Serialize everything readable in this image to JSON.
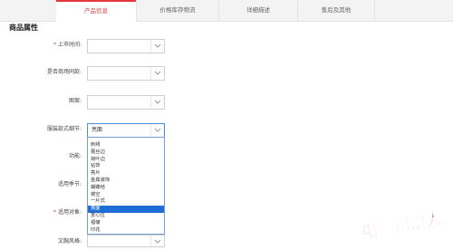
{
  "tabs": [
    "产品信息",
    "价格库存物流",
    "详细描述",
    "售后及其他"
  ],
  "section_title": "商品属性",
  "fields": [
    {
      "label": "上市时间:",
      "required": true,
      "value": ""
    },
    {
      "label": "是否商场同款:",
      "required": false,
      "value": ""
    },
    {
      "label": "图案:",
      "required": false,
      "value": ""
    },
    {
      "label": "服装款式细节:",
      "required": false,
      "value": "亮面"
    },
    {
      "label": "功能:",
      "required": false,
      "value": ""
    },
    {
      "label": "适用季节:",
      "required": false,
      "value": ""
    },
    {
      "label": "适用对象:",
      "required": true,
      "value": ""
    },
    {
      "label": "文胸风格:",
      "required": false,
      "value": ""
    }
  ],
  "dropdown": {
    "options": [
      "刺绣",
      "蕾丝边",
      "荷叶边",
      "钻饰",
      "亮片",
      "金属装饰",
      "蝴蝶结",
      "镂空",
      "一片式",
      "亮面",
      "爱心位",
      "褶皱",
      "印花"
    ],
    "selected": "亮面"
  },
  "watermark": "电商知识人",
  "colors": {
    "accent": "#e4393c",
    "selected_bg": "#1e6ed6",
    "focus_border": "#4a90d9"
  }
}
